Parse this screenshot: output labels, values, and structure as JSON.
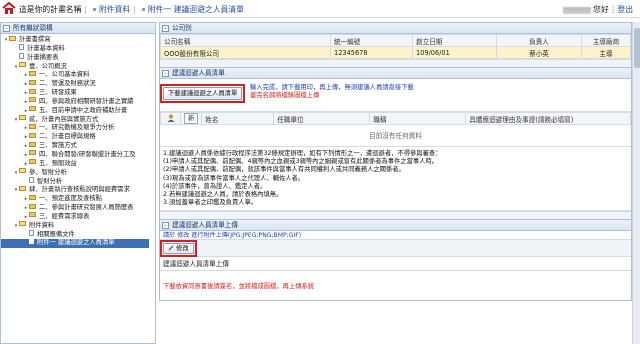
{
  "header": {
    "project_name": "這是你的計畫名稱",
    "crumb1": "附件資料",
    "crumb2": "附件一 建議迴避之人員清單",
    "greeting": "您好",
    "logout": "登出"
  },
  "sidebar": {
    "title": "所有繼狀頭構",
    "items": [
      {
        "label": "計畫書撰寫",
        "level": 0,
        "type": "folder"
      },
      {
        "label": "計畫基本資料",
        "level": 1,
        "type": "page"
      },
      {
        "label": "計畫摘要表",
        "level": 1,
        "type": "page"
      },
      {
        "label": "壹、公司概況",
        "level": 1,
        "type": "folder"
      },
      {
        "label": "一、公司基本資料",
        "level": 2,
        "type": "folder"
      },
      {
        "label": "二、營運及財務狀況",
        "level": 2,
        "type": "folder"
      },
      {
        "label": "三、研發成果",
        "level": 2,
        "type": "folder"
      },
      {
        "label": "四、參與政府相關研發計畫之實績",
        "level": 2,
        "type": "folder"
      },
      {
        "label": "五、目前申請中之政府補助計畫",
        "level": 2,
        "type": "folder"
      },
      {
        "label": "貳、計畫內容與實施方式",
        "level": 1,
        "type": "folder"
      },
      {
        "label": "一、研究動機及競爭力分析",
        "level": 2,
        "type": "folder"
      },
      {
        "label": "二、計畫目標與規格",
        "level": 2,
        "type": "folder"
      },
      {
        "label": "三、實施方式",
        "level": 2,
        "type": "folder"
      },
      {
        "label": "四、聯合開發/研發聯盟計畫分工及",
        "level": 2,
        "type": "folder"
      },
      {
        "label": "五、預期效益",
        "level": 2,
        "type": "folder"
      },
      {
        "label": "參、智財分析",
        "level": 1,
        "type": "folder"
      },
      {
        "label": "智財分析",
        "level": 2,
        "type": "page"
      },
      {
        "label": "肆、計畫執行查核點說明與經費需求",
        "level": 1,
        "type": "folder"
      },
      {
        "label": "一、預定進度及查核點",
        "level": 2,
        "type": "folder"
      },
      {
        "label": "二、參與計畫研究發展人員簡歷表",
        "level": 2,
        "type": "folder"
      },
      {
        "label": "三、經費需求總表",
        "level": 2,
        "type": "folder"
      },
      {
        "label": "附件資料",
        "level": 1,
        "type": "folder"
      },
      {
        "label": "相關應備文件",
        "level": 2,
        "type": "page"
      },
      {
        "label": "附件一 建議迴避之人員清單",
        "level": 2,
        "type": "page",
        "selected": true
      }
    ]
  },
  "company": {
    "section_title": "公司別",
    "headers": [
      "公司名稱",
      "統一編號",
      "創立日期",
      "負責人",
      "主導廠商"
    ],
    "row": [
      "OOO股份有限公司",
      "12345678",
      "109/06/01",
      "蔡小英",
      "主導"
    ]
  },
  "avoid": {
    "section_title": "建議迴避人員清單",
    "download_button": "下載建議迴避之人員清單",
    "note_blue": "輸入完成，請下載用印，再上傳，無須建議人員請直接下載",
    "note_red": "蓋完名調將檔錄圖檔上傳",
    "new_button": "新",
    "col_headers": [
      "姓名",
      "任職單位",
      "職稱",
      "具體應迴避理由及事證(請務必填寫)"
    ],
    "empty_text": "目前沒有任何資料",
    "rules": [
      "1.建議迴避人員係依據行政程序法第32條規定辦理，如有下列情形之一，遭迴避者，不得參與審查：",
      "(1)申請人或其配偶、前配偶、4親等內之血親或3親等內之姻親或曾有此關係者為事件之當事人時。",
      "(2)申請人或其配偶、前配偶，就該事件與當事人有共同權利人或共同義務人之關係者。",
      "(3)現為或曾為該事件當事人之代理人、輔佐人者。",
      "(4)於該事件，曾為證人、鑑定人者。",
      "2.若無建議迴避之人員，請於表格內填無。",
      "3.須加蓋章者之印鑑及負責人章。"
    ]
  },
  "upload": {
    "section_title": "建議迴避人員清單上傳",
    "hint": "請於 修改 進行附件上傳(JPG;JPEG;PNG;BMP;GIF)",
    "edit_button": "修改",
    "row_label": "建議迴避人員清單上傳",
    "red_note": "下載依資同意書後請簽名，並將檔成圖檔，再上傳系統"
  }
}
